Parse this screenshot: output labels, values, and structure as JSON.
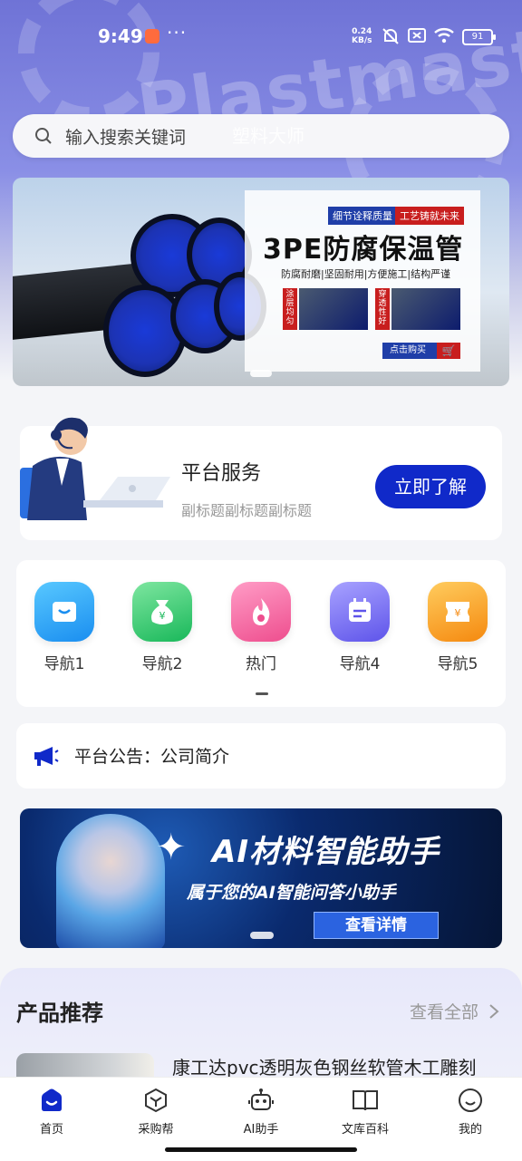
{
  "status_bar": {
    "time": "9:49",
    "more": "···",
    "speed_value": "0.24",
    "speed_unit": "KB/s",
    "battery": "91"
  },
  "search": {
    "placeholder": "输入搜索关键词",
    "brand_text": "塑料大师"
  },
  "banner": {
    "tag_left": "细节诠释质量",
    "tag_right": "工艺铸就未来",
    "title": "3PE防腐保温管",
    "subtitle": "防腐耐磨|坚固耐用|方便施工|结构严谨",
    "side_tag_1": "涂层均匀",
    "side_tag_2": "穿透性好",
    "buy_label": "点击购买",
    "cart_icon": "cart-icon"
  },
  "service": {
    "title": "平台服务",
    "subtitle": "副标题副标题副标题",
    "button": "立即了解"
  },
  "nav": {
    "items": [
      {
        "label": "导航1",
        "icon": "bag-icon",
        "color": "#1a9cf0"
      },
      {
        "label": "导航2",
        "icon": "money-bag-icon",
        "color": "#27c46a"
      },
      {
        "label": "热门",
        "icon": "flame-icon",
        "color": "#f0589a"
      },
      {
        "label": "导航4",
        "icon": "calendar-icon",
        "color": "#6b63f0"
      },
      {
        "label": "导航5",
        "icon": "coupon-icon",
        "color": "#f79b1a"
      }
    ]
  },
  "notice": {
    "text": "平台公告：公司简介"
  },
  "ai_banner": {
    "title": "AI材料智能助手",
    "subtitle": "属于您的AI智能问答小助手",
    "button": "查看详情"
  },
  "products": {
    "heading": "产品推荐",
    "view_all": "查看全部",
    "first_item_name": "康工达pvc透明灰色钢丝软管木工雕刻"
  },
  "tabbar": {
    "items": [
      {
        "label": "首页",
        "icon": "home-icon",
        "active": true
      },
      {
        "label": "采购帮",
        "icon": "cube-icon",
        "active": false
      },
      {
        "label": "AI助手",
        "icon": "robot-icon",
        "active": false
      },
      {
        "label": "文库百科",
        "icon": "book-icon",
        "active": false
      },
      {
        "label": "我的",
        "icon": "smile-icon",
        "active": false
      }
    ]
  },
  "colors": {
    "accent": "#1029c9",
    "active_tab": "#1029c9"
  }
}
